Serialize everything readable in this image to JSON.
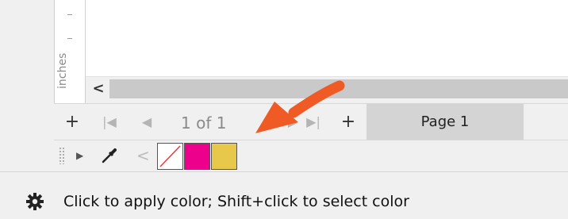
{
  "ruler": {
    "unit_label": "inches"
  },
  "page_nav": {
    "add_before_label": "+",
    "first_label": "|◀",
    "prev_label": "◀",
    "page_count": "1 of 1",
    "next_label": "▶",
    "last_label": "▶|",
    "add_after_label": "+",
    "page_tab_label": "Page 1"
  },
  "hscroll": {
    "left_arrow": "<"
  },
  "palette": {
    "scroll_left": "<",
    "swatches": [
      {
        "name": "none",
        "color": "#ffffff"
      },
      {
        "name": "magenta",
        "color": "#ec008c"
      },
      {
        "name": "yellow",
        "color": "#e8c84a"
      }
    ]
  },
  "status": {
    "text": "Click to apply color; Shift+click to select color"
  },
  "annotation": {
    "arrow_color": "#f05a24"
  }
}
